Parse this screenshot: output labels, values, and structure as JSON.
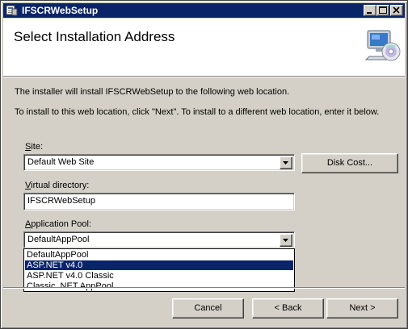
{
  "window": {
    "title": "IFSCRWebSetup",
    "caption_buttons": [
      "minimize",
      "maximize",
      "close"
    ]
  },
  "header": {
    "title": "Select Installation Address",
    "icon": "computer-with-cd-icon"
  },
  "body": {
    "line1": "The installer will install IFSCRWebSetup to the following web location.",
    "line2": "To install to this web location, click \"Next\". To install to a different web location, enter it below."
  },
  "site": {
    "label_hotkey": "S",
    "label_rest": "ite:",
    "value": "Default Web Site"
  },
  "disk_cost_button": "Disk Cost...",
  "virtual_directory": {
    "label_hotkey": "V",
    "label_rest": "irtual directory:",
    "value": "IFSCRWebSetup"
  },
  "app_pool": {
    "label_hotkey": "A",
    "label_rest": "pplication Pool:",
    "value": "DefaultAppPool",
    "options": [
      "DefaultAppPool",
      "ASP.NET v4.0",
      "ASP.NET v4.0 Classic",
      "Classic .NET AppPool"
    ],
    "highlighted": "ASP.NET v4.0"
  },
  "buttons": {
    "cancel": "Cancel",
    "back": "< Back",
    "next": "Next >"
  }
}
